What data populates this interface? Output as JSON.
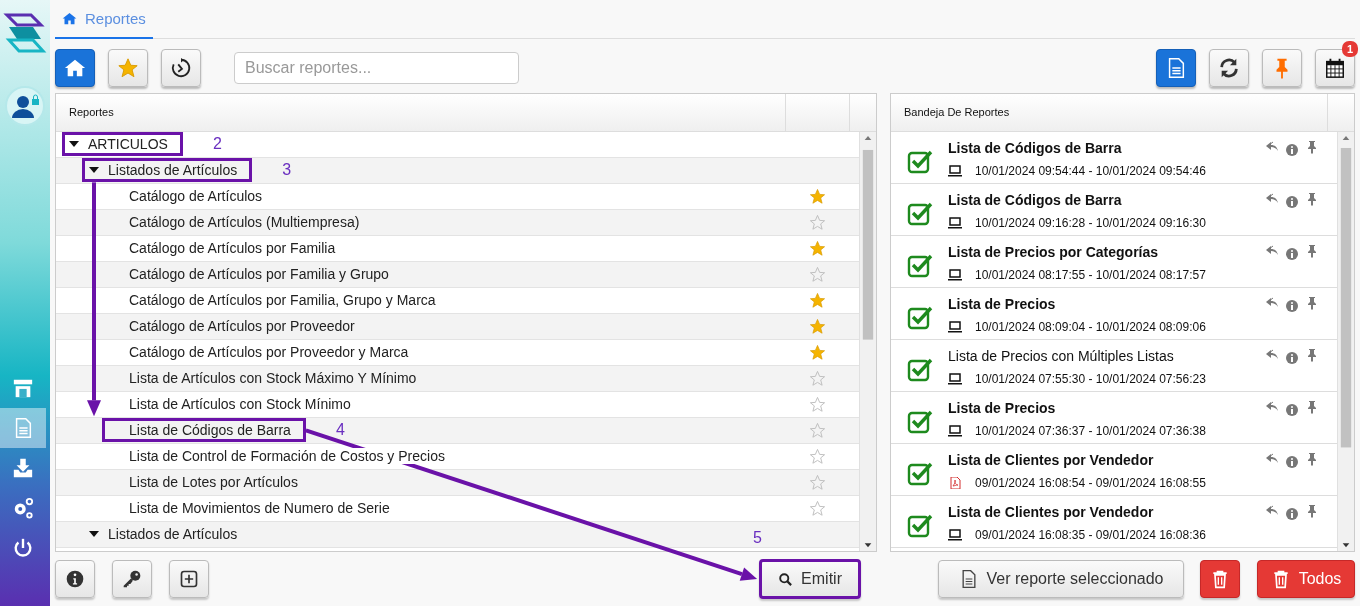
{
  "sidebar": {
    "items": [
      {
        "kind": "store",
        "selected": false
      },
      {
        "kind": "document",
        "selected": true
      },
      {
        "kind": "download",
        "selected": false
      },
      {
        "kind": "settings",
        "selected": false
      },
      {
        "kind": "power",
        "selected": false
      }
    ]
  },
  "tabs": [
    {
      "label": "Reportes",
      "selected": true
    }
  ],
  "toolbar": {
    "left": [
      {
        "kind": "home",
        "selected": true
      },
      {
        "kind": "star",
        "selected": false
      },
      {
        "kind": "history",
        "selected": false
      }
    ],
    "search": {
      "placeholder": "Buscar reportes..."
    },
    "right": [
      {
        "kind": "document",
        "selected": true
      },
      {
        "kind": "refresh",
        "selected": false
      },
      {
        "kind": "pin",
        "selected": false
      },
      {
        "kind": "calendar",
        "selected": false,
        "badge": "1"
      }
    ]
  },
  "reports_panel": {
    "header": "Reportes",
    "tree": [
      {
        "label": "ARTICULOS",
        "expanded": true,
        "highlighted": true,
        "callout": "2",
        "children": [
          {
            "label": "Listados de Artículos",
            "expanded": true,
            "highlighted": true,
            "callout": "3",
            "children": [
              {
                "label": "Catálogo de Artículos",
                "starred": true,
                "highlighted": false
              },
              {
                "label": "Catálogo de Artículos (Multiempresa)",
                "starred": false,
                "highlighted": false
              },
              {
                "label": "Catálogo de Artículos por Familia",
                "starred": true,
                "highlighted": false
              },
              {
                "label": "Catálogo de Artículos por Familia y Grupo",
                "starred": false,
                "highlighted": false
              },
              {
                "label": "Catálogo de Artículos por Familia, Grupo y Marca",
                "starred": true,
                "highlighted": false
              },
              {
                "label": "Catálogo de Artículos por Proveedor",
                "starred": true,
                "highlighted": false
              },
              {
                "label": "Catálogo de Artículos por Proveedor y Marca",
                "starred": true,
                "highlighted": false
              },
              {
                "label": "Lista de Artículos con Stock Máximo Y Mínimo",
                "starred": false,
                "highlighted": false
              },
              {
                "label": "Lista de Artículos con Stock Mínimo",
                "starred": false,
                "highlighted": false
              },
              {
                "label": "Lista de Códigos de Barra",
                "starred": false,
                "highlighted": true,
                "callout": "4"
              },
              {
                "label": "Lista de Control de Formación de Costos y Precios",
                "starred": false,
                "highlighted": false
              },
              {
                "label": "Lista de Lotes por Artículos",
                "starred": false,
                "highlighted": false
              },
              {
                "label": "Lista de Movimientos de Numero de Serie",
                "starred": false,
                "highlighted": false
              }
            ]
          },
          {
            "label": "Listados de Artículos",
            "expanded": true,
            "highlighted": false
          }
        ]
      }
    ]
  },
  "tray_panel": {
    "header": "Bandeja De Reportes",
    "items": [
      {
        "title": "Lista de Códigos de Barra",
        "bold": true,
        "kind": "screen",
        "time": "10/01/2024 09:54:44 - 10/01/2024 09:54:46"
      },
      {
        "title": "Lista de Códigos de Barra",
        "bold": true,
        "kind": "screen",
        "time": "10/01/2024 09:16:28 - 10/01/2024 09:16:30"
      },
      {
        "title": "Lista de Precios por Categorías",
        "bold": true,
        "kind": "screen",
        "time": "10/01/2024 08:17:55 - 10/01/2024 08:17:57"
      },
      {
        "title": "Lista de Precios",
        "bold": true,
        "kind": "screen",
        "time": "10/01/2024 08:09:04 - 10/01/2024 08:09:06"
      },
      {
        "title": "Lista de Precios con Múltiples Listas",
        "bold": false,
        "kind": "screen",
        "time": "10/01/2024 07:55:30 - 10/01/2024 07:56:23"
      },
      {
        "title": "Lista de Precios",
        "bold": true,
        "kind": "screen",
        "time": "10/01/2024 07:36:37 - 10/01/2024 07:36:38"
      },
      {
        "title": "Lista de Clientes por Vendedor",
        "bold": true,
        "kind": "pdf",
        "time": "09/01/2024 16:08:54 - 09/01/2024 16:08:55"
      },
      {
        "title": "Lista de Clientes por Vendedor",
        "bold": true,
        "kind": "screen",
        "time": "09/01/2024 16:08:35 - 09/01/2024 16:08:36"
      }
    ]
  },
  "bottom_left": [
    {
      "kind": "info"
    },
    {
      "kind": "key"
    },
    {
      "kind": "add"
    }
  ],
  "emit_button": {
    "label": "Emitir",
    "highlighted": true,
    "callout": "5"
  },
  "bottom_right": [
    {
      "kind": "view",
      "label": "Ver reporte seleccionado"
    },
    {
      "kind": "delete"
    },
    {
      "kind": "delete_all",
      "label": "Todos"
    }
  ]
}
